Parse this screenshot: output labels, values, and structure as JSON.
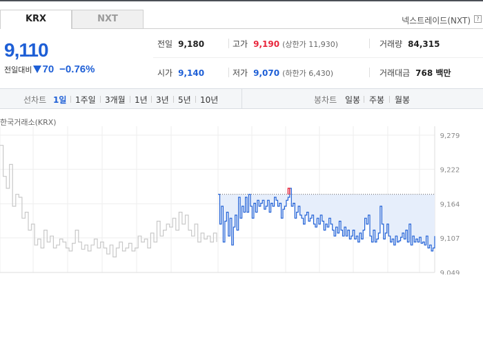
{
  "tabs": [
    {
      "label": "KRX",
      "active": true
    },
    {
      "label": "NXT",
      "active": false
    }
  ],
  "nxt_link": "넥스트레이드(NXT)",
  "help_icon": "?",
  "price": {
    "current": "9,110",
    "change_label": "전일대비",
    "change_value": "70",
    "change_pct": "−0.76%",
    "direction_icon": "down-triangle-icon",
    "color": "#1e5fd6"
  },
  "stats": {
    "prev_close": {
      "label": "전일",
      "value": "9,180"
    },
    "high": {
      "label": "고가",
      "value": "9,190",
      "sub": "(상한가 11,930)"
    },
    "volume": {
      "label": "거래량",
      "value": "84,315"
    },
    "open": {
      "label": "시가",
      "value": "9,140"
    },
    "low": {
      "label": "저가",
      "value": "9,070",
      "sub": "(하한가 6,430)"
    },
    "amount": {
      "label": "거래대금",
      "value": "768 백만"
    }
  },
  "controls": {
    "line_chart_label": "선차트",
    "periods": [
      "1일",
      "1주일",
      "3개월",
      "1년",
      "3년",
      "5년",
      "10년"
    ],
    "active_period": "1일",
    "candle_chart_label": "봉차트",
    "candle_periods": [
      "일봉",
      "주봉",
      "월봉"
    ]
  },
  "exchange_label": "한국거래소(KRX)",
  "colors": {
    "up": "#e8253b",
    "down": "#1e5fd6",
    "prev_day_line": "#c8c8c8",
    "fill": "#e6eefb"
  },
  "chart_data": {
    "type": "line",
    "y_ticks": [
      "9,279",
      "9,222",
      "9,164",
      "9,107",
      "9,049"
    ],
    "ylim": [
      9049,
      9279
    ],
    "reference_level": 9180,
    "series": [
      {
        "values": [
          9262,
          9210,
          9190,
          9230,
          9160,
          9180,
          9175,
          9140,
          9150,
          9120,
          9130,
          9095,
          9105,
          9090,
          9120,
          9100,
          9110,
          9090,
          9095,
          9105,
          9100,
          9090,
          9085,
          9098,
          9120,
          9100,
          9088,
          9095,
          9085,
          9095,
          9105,
          9090,
          9100,
          9090,
          9080,
          9095,
          9075,
          9090,
          9100,
          9085,
          9090,
          9098,
          9085,
          9090,
          9110,
          9100,
          9105,
          9090,
          9115,
          9100,
          9135,
          9110,
          9120,
          9130,
          9125,
          9140,
          9120,
          9150,
          9130,
          9145,
          9120,
          9110,
          9130,
          9100,
          9115,
          9105,
          9110,
          9100,
          9115,
          9100
        ]
      },
      {
        "values": [
          9180,
          9130,
          9160,
          9100,
          9135,
          9150,
          9110,
          9140,
          9095,
          9125,
          9145,
          9120,
          9175,
          9140,
          9160,
          9150,
          9175,
          9150,
          9180,
          9160,
          9140,
          9165,
          9150,
          9170,
          9160,
          9165,
          9170,
          9155,
          9160,
          9170,
          9150,
          9165,
          9160,
          9175,
          9170,
          9160,
          9165,
          9140,
          9155,
          9160,
          9170,
          9175,
          9190,
          9160,
          9165,
          9140,
          9150,
          9160,
          9145,
          9140,
          9130,
          9145,
          9150,
          9135,
          9140,
          9145,
          9130,
          9125,
          9140,
          9130,
          9145,
          9135,
          9120,
          9130,
          9125,
          9140,
          9130,
          9120,
          9110,
          9125,
          9115,
          9135,
          9120,
          9110,
          9125,
          9110,
          9120,
          9105,
          9110,
          9120,
          9105,
          9110,
          9100,
          9115,
          9105,
          9120,
          9140,
          9130,
          9145,
          9110,
          9100,
          9120,
          9100,
          9105,
          9115,
          9160,
          9130,
          9105,
          9115,
          9130,
          9110,
          9100,
          9105,
          9095,
          9110,
          9100,
          9102,
          9108,
          9115,
          9105,
          9120,
          9100,
          9130,
          9095,
          9110,
          9100,
          9105,
          9100,
          9108,
          9098,
          9100,
          9095,
          9110,
          9090,
          9095,
          9085,
          9090,
          9110
        ]
      }
    ]
  }
}
